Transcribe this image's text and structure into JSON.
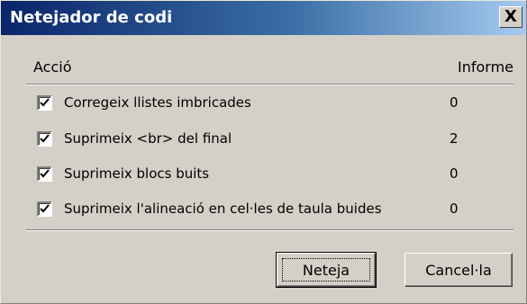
{
  "window": {
    "title": "Netejador de codi",
    "close_label": "X"
  },
  "table": {
    "col_action": "Acció",
    "col_report": "Informe",
    "rows": [
      {
        "label": "Corregeix llistes imbricades",
        "count": "0",
        "checked": true
      },
      {
        "label": "Suprimeix <br> del final",
        "count": "2",
        "checked": true
      },
      {
        "label": "Suprimeix blocs buits",
        "count": "0",
        "checked": true
      },
      {
        "label": "Suprimeix l'alineació en cel·les de taula buides",
        "count": "0",
        "checked": true
      }
    ]
  },
  "buttons": {
    "ok_label": "Neteja",
    "cancel_label": "Cancel·la"
  },
  "colors": {
    "titlebar_start": "#0a246a",
    "titlebar_end": "#a6caf0",
    "face": "#d4d0c8"
  }
}
